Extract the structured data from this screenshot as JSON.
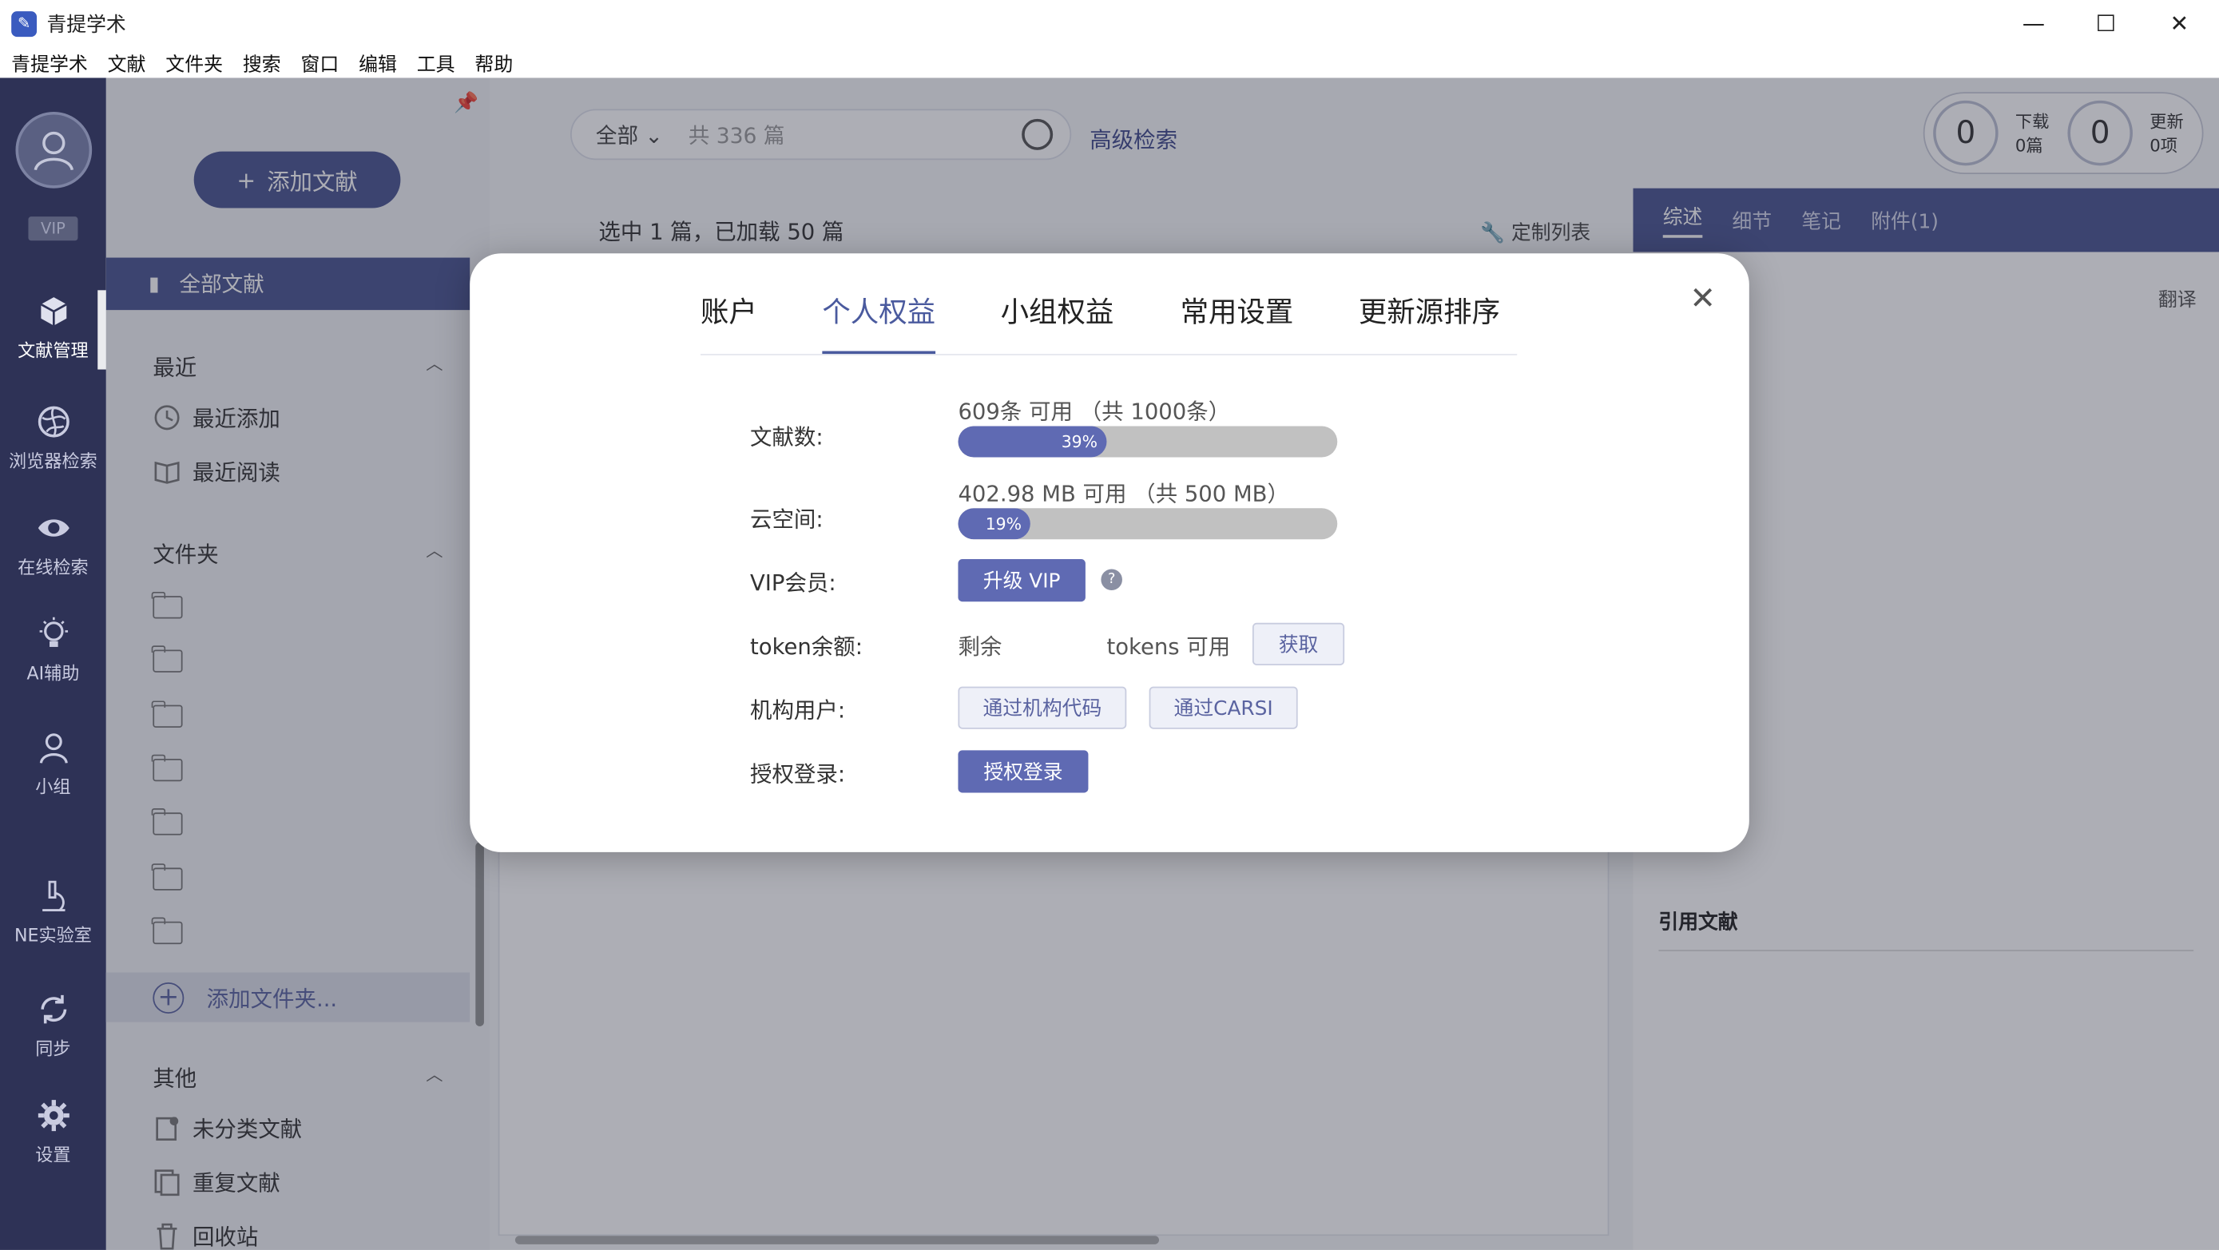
{
  "window": {
    "title": "青提学术",
    "minimize": "—",
    "maximize": "☐",
    "close": "✕"
  },
  "menu": [
    "青提学术",
    "文献",
    "文件夹",
    "搜索",
    "窗口",
    "编辑",
    "工具",
    "帮助"
  ],
  "rail": {
    "vip": "VIP",
    "items": [
      {
        "label": "文献管理",
        "icon": "cube-icon"
      },
      {
        "label": "浏览器检索",
        "icon": "globe-icon"
      },
      {
        "label": "在线检索",
        "icon": "eye-icon"
      },
      {
        "label": "AI辅助",
        "icon": "bulb-icon"
      },
      {
        "label": "小组",
        "icon": "group-icon"
      },
      {
        "label": "NE实验室",
        "icon": "microscope-icon"
      },
      {
        "label": "同步",
        "icon": "sync-icon"
      },
      {
        "label": "设置",
        "icon": "gear-icon"
      }
    ]
  },
  "side": {
    "add_btn": "添加文献",
    "all_docs": "全部文献",
    "recent_title": "最近",
    "recent_items": [
      "最近添加",
      "最近阅读"
    ],
    "folders_title": "文件夹",
    "add_folder": "添加文件夹...",
    "other_title": "其他",
    "other_items": [
      "未分类文献",
      "重复文献",
      "回收站"
    ]
  },
  "main": {
    "search_scope": "全部",
    "search_placeholder": "共 336 篇",
    "advanced": "高级检索",
    "download_count": "0",
    "download_label": "下载",
    "download_sub": "0篇",
    "update_count": "0",
    "update_label": "更新",
    "update_sub": "0项",
    "selection_info": "选中 1 篇，已加载 50 篇",
    "custom_list": "定制列表",
    "right_tabs": [
      "综述",
      "细节",
      "笔记",
      "附件(1)"
    ],
    "translate": "翻译",
    "cite_title": "引用文献"
  },
  "dialog": {
    "tabs": [
      "账户",
      "个人权益",
      "小组权益",
      "常用设置",
      "更新源排序"
    ],
    "active_tab": "个人权益",
    "docs_label": "文献数:",
    "docs_text": "609条 可用 （共 1000条）",
    "docs_percent": 0.39,
    "docs_percent_label": "39%",
    "space_label": "云空间:",
    "space_text": "402.98 MB 可用 （共 500 MB）",
    "space_percent": 0.19,
    "space_percent_label": "19%",
    "vip_label": "VIP会员:",
    "vip_btn": "升级 VIP",
    "help": "?",
    "token_label": "token余额:",
    "token_prefix": "剩余",
    "token_suffix": "tokens 可用",
    "token_btn": "获取",
    "inst_label": "机构用户:",
    "inst_btn1": "通过机构代码",
    "inst_btn2": "通过CARSI",
    "auth_label": "授权登录:",
    "auth_btn": "授权登录",
    "close": "✕"
  },
  "colors": {
    "rail_bg": "#2e3256",
    "accent": "#4a5490",
    "bar_fill": "#5f6ab3",
    "bar_track": "#c1c1c1"
  }
}
